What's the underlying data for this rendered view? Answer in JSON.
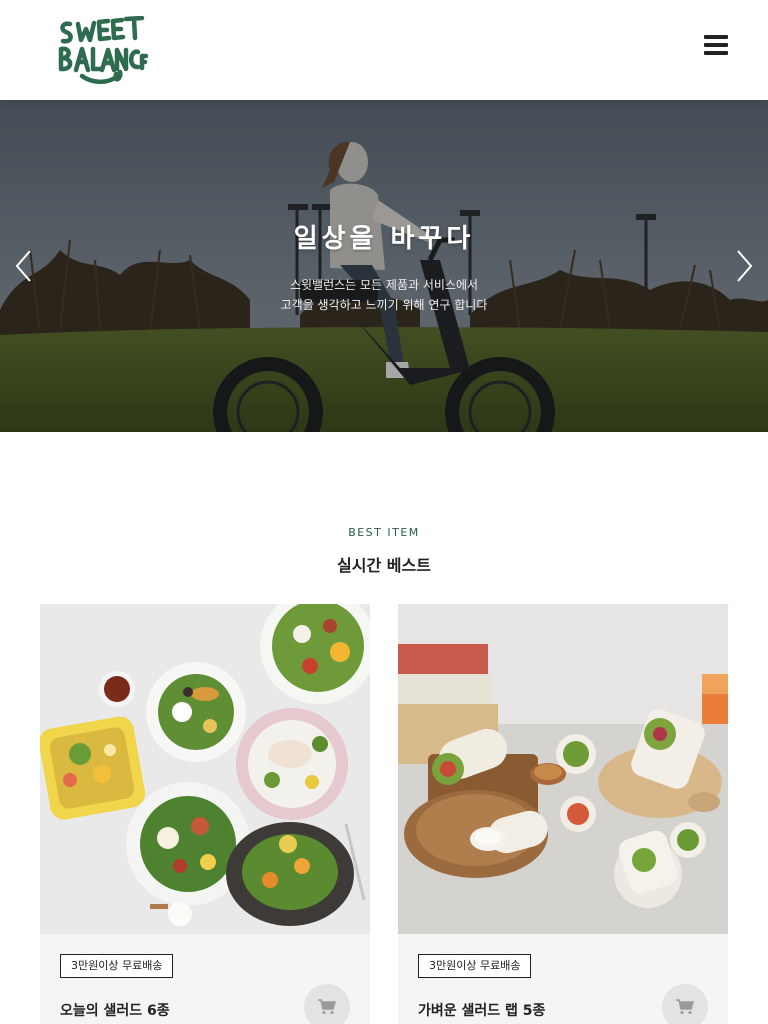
{
  "brand": {
    "logo_line1": "SWEET",
    "logo_line2": "BALANCE",
    "color": "#2e6b4f"
  },
  "header": {
    "menu_icon": "hamburger-menu-icon"
  },
  "hero": {
    "title": "일상을 바꾸다",
    "subtitle_line1": "스윗밸런스는 모든 제품과 서비스에서",
    "subtitle_line2": "고객을 생각하고 느끼기 위해 연구 합니다",
    "prev_icon": "chevron-left-icon",
    "next_icon": "chevron-right-icon"
  },
  "best": {
    "label": "BEST ITEM",
    "title": "실시간 베스트",
    "products": [
      {
        "badge": "3만원이상 무료배송",
        "name": "오늘의 샐러드 6종",
        "cart_icon": "cart-icon"
      },
      {
        "badge": "3만원이상 무료배송",
        "name": "가벼운 샐러드 랩 5종",
        "cart_icon": "cart-icon"
      }
    ]
  }
}
